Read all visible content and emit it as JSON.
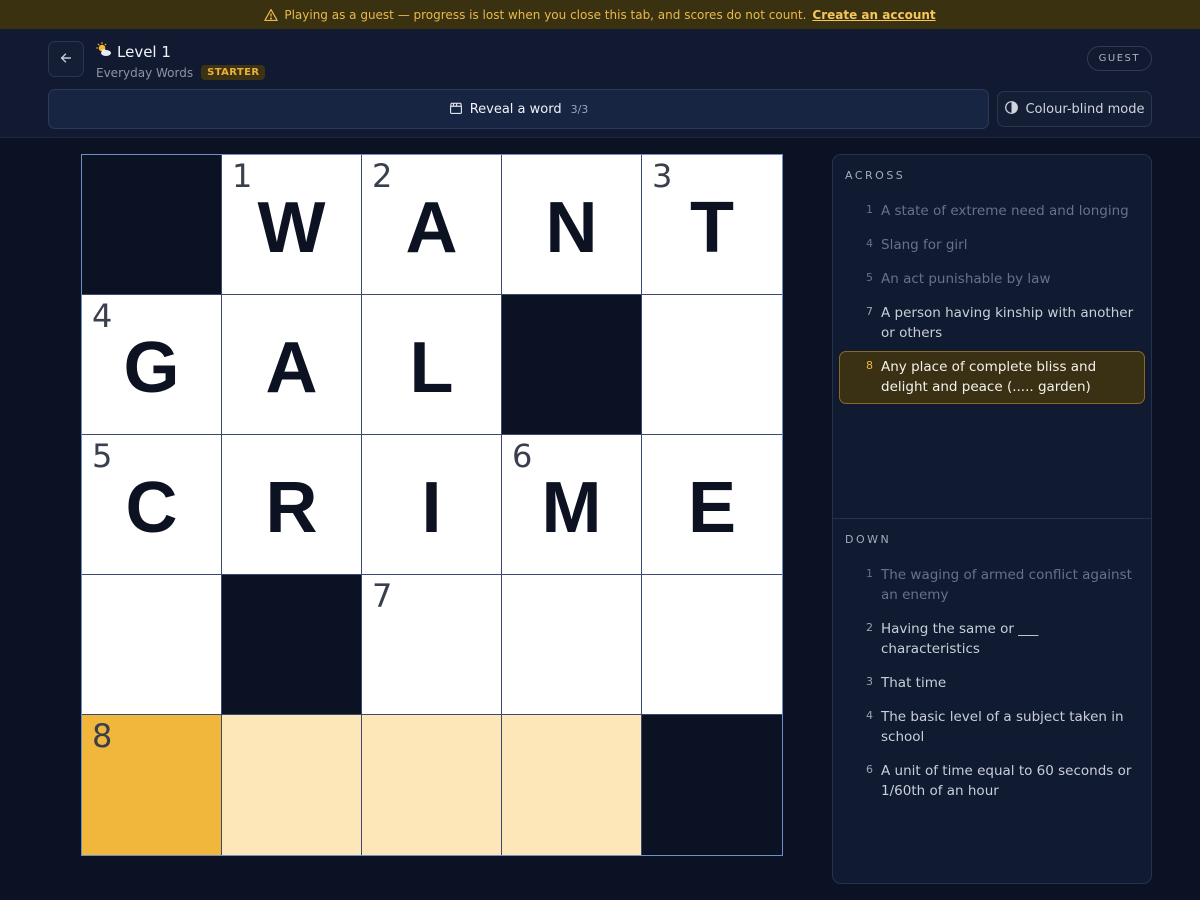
{
  "banner": {
    "message": "Playing as a guest — progress is lost when you close this tab, and scores do not count.",
    "link": "Create an account"
  },
  "header": {
    "title": "Level 1",
    "subtitle": "Everyday Words",
    "badge": "STARTER",
    "guest_label": "GUEST",
    "reveal_label": "Reveal a word",
    "reveal_count": "3/3",
    "colorblind_label": "Colour-blind mode"
  },
  "grid": {
    "size": 5,
    "cells": [
      [
        {
          "type": "block"
        },
        {
          "num": "1",
          "letter": "W"
        },
        {
          "num": "2",
          "letter": "A"
        },
        {
          "letter": "N"
        },
        {
          "num": "3",
          "letter": "T"
        }
      ],
      [
        {
          "num": "4",
          "letter": "G"
        },
        {
          "letter": "A"
        },
        {
          "letter": "L"
        },
        {
          "type": "block"
        },
        {
          "letter": ""
        }
      ],
      [
        {
          "num": "5",
          "letter": "C"
        },
        {
          "letter": "R"
        },
        {
          "letter": "I"
        },
        {
          "num": "6",
          "letter": "M"
        },
        {
          "letter": "E"
        }
      ],
      [
        {
          "letter": ""
        },
        {
          "type": "block"
        },
        {
          "num": "7",
          "letter": ""
        },
        {
          "letter": ""
        },
        {
          "letter": ""
        }
      ],
      [
        {
          "num": "8",
          "letter": "",
          "state": "active"
        },
        {
          "letter": "",
          "state": "word"
        },
        {
          "letter": "",
          "state": "word"
        },
        {
          "letter": "",
          "state": "word"
        },
        {
          "type": "block"
        }
      ]
    ]
  },
  "clues": {
    "across_title": "ACROSS",
    "down_title": "DOWN",
    "across": [
      {
        "num": "1",
        "text": "A state of extreme need and longing",
        "state": "dim"
      },
      {
        "num": "4",
        "text": "Slang for girl",
        "state": "dim"
      },
      {
        "num": "5",
        "text": "An act punishable by law",
        "state": "dim"
      },
      {
        "num": "7",
        "text": "A person having kinship with another or others",
        "state": ""
      },
      {
        "num": "8",
        "text": "Any place of complete bliss and delight and peace (..... garden)",
        "state": "active"
      }
    ],
    "down": [
      {
        "num": "1",
        "text": "The waging of armed conflict against an enemy",
        "state": "dim"
      },
      {
        "num": "2",
        "text": "Having the same or ___ characteristics",
        "state": ""
      },
      {
        "num": "3",
        "text": "That time",
        "state": ""
      },
      {
        "num": "4",
        "text": "The basic level of a subject taken in school",
        "state": ""
      },
      {
        "num": "6",
        "text": "A unit of time equal to 60 seconds or 1/60th of an hour",
        "state": ""
      }
    ]
  },
  "colors": {
    "accent": "#f1b73d",
    "word_highlight": "#fde6b8",
    "block": "#0b1224"
  }
}
